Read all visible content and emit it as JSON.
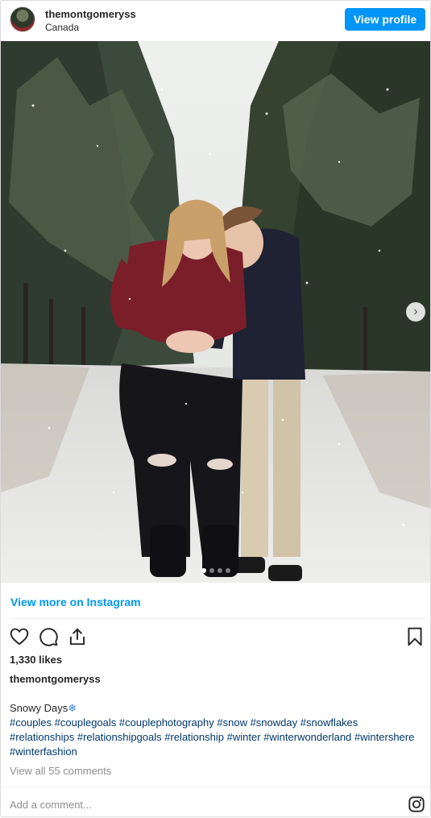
{
  "header": {
    "username": "themontgomeryss",
    "location": "Canada",
    "view_profile_label": "View profile"
  },
  "carousel": {
    "slide_count": 4,
    "active_slide": 1
  },
  "view_more_label": "View more on Instagram",
  "likes_label": "1,330 likes",
  "post_owner": "themontgomeryss",
  "caption": {
    "text": "Snowy Days",
    "emoji": "❄",
    "hashtags": [
      "#couples",
      "#couplegoals",
      "#couplephotography",
      "#snow",
      "#snowday",
      "#snowflakes",
      "#relationships",
      "#relationshipgoals",
      "#relationship",
      "#winter",
      "#winterwonderland",
      "#wintershere",
      "#winterfashion"
    ]
  },
  "view_comments_label": "View all 55 comments",
  "add_comment_placeholder": "Add a comment...",
  "colors": {
    "accent": "#0095f6",
    "hashtag": "#00376b",
    "muted": "#8e8e8e"
  },
  "icons": [
    "heart-icon",
    "comment-icon",
    "share-icon",
    "bookmark-icon",
    "chevron-right-icon",
    "instagram-logo-icon"
  ]
}
